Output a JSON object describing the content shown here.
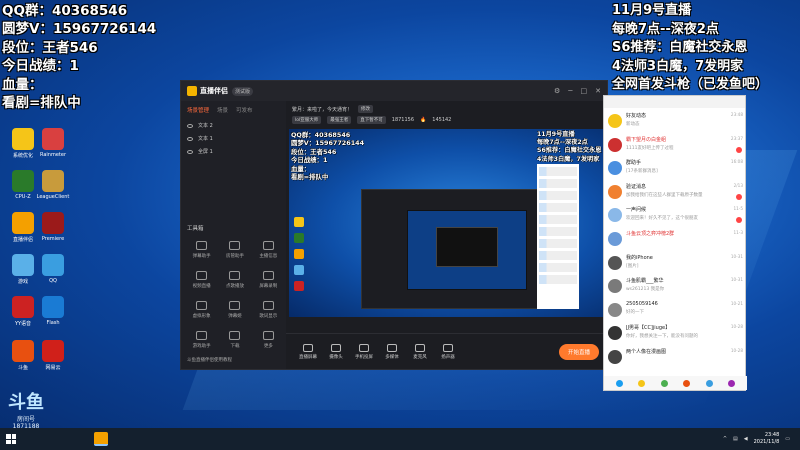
{
  "overlay_left": {
    "line1": "QQ群：40368546",
    "line2": "圆梦V：15967726144",
    "line3": "段位：王者546",
    "line4": "今日战绩：1",
    "line5": "血量：",
    "line6": "看剧=排队中"
  },
  "overlay_right": {
    "line1": "11月9号直播",
    "line2": "每晚7点--深夜2点",
    "line3": "S6推荐：白魔社交永恩",
    "line4": "4法师3白魔，7发明家",
    "line5": "全网首发斗枪（已发鱼吧）"
  },
  "desktop_icons": [
    {
      "label": "系统优化",
      "color": "#f5c518"
    },
    {
      "label": "Rainmeter",
      "color": "#d94040"
    },
    {
      "label": "CPU-Z",
      "color": "#2a7a2a"
    },
    {
      "label": "LeagueClient",
      "color": "#c89b3c"
    },
    {
      "label": "直播伴侣",
      "color": "#f4a000"
    },
    {
      "label": "Premiere",
      "color": "#9b1a1a"
    },
    {
      "label": "游戏",
      "color": "#5ab0e8"
    },
    {
      "label": "QQ",
      "color": "#3a9ee0"
    },
    {
      "label": "YY语音",
      "color": "#c22"
    },
    {
      "label": "Flash",
      "color": "#1a7bd4"
    },
    {
      "label": "斗鱼",
      "color": "#e85010"
    },
    {
      "label": "网易云",
      "color": "#d0201a"
    }
  ],
  "app": {
    "logo": "直播伴侣",
    "version": "测试版",
    "side_tabs": [
      "场景管理",
      "场景",
      "可发布"
    ],
    "scenes": [
      "文本 2",
      "文本 1",
      "全屏 1"
    ],
    "tools_title": "工具箱",
    "tools": [
      "弹幕助手",
      "房管助手",
      "主播信息",
      "视频直播",
      "点歌播放",
      "屏幕录制",
      "虚拟形象",
      "弹幕姬",
      "歌词显示",
      "游戏助手",
      "下载",
      "更多"
    ],
    "info_line": "繁月：来啦了，今天通宵！",
    "info_btn": "修改",
    "room_badge": "lol亚服大师",
    "rank_badge": "最强王者",
    "audience_label": "直下暂不可",
    "audience_count": "1871156",
    "hot_count": "145142",
    "bottom_tools": [
      "直播屏幕",
      "摄像头",
      "手机投屏",
      "多媒体",
      "麦克风",
      "扬声器"
    ],
    "start_live": "开始直播",
    "tip": "斗鱼直播伴侣使用教程"
  },
  "qq": {
    "items": [
      {
        "name": "好友动态",
        "msg": "新动态",
        "time": "23:48",
        "color": "#f5c518",
        "dot": false
      },
      {
        "name": "霸下望月の白金組",
        "msg": "1111友好吧上传了过程",
        "time": "23:37",
        "color": "#cc3030",
        "dot": true,
        "red": true
      },
      {
        "name": "群助手",
        "msg": "[17条新群消息]",
        "time": "16:08",
        "color": "#4a8fe0",
        "dot": false
      },
      {
        "name": "验证消息",
        "msg": "加我给我们在这些人群里下载原子数量",
        "time": "2/13",
        "color": "#f08030",
        "dot": true
      },
      {
        "name": "一声问候",
        "msg": "欢迎回来！好久不见了，这个很朋友",
        "time": "11-5",
        "color": "#8ab8e8",
        "dot": true
      },
      {
        "name": "斗鱼云顶之弈冲榜2群",
        "msg": "",
        "time": "11-3",
        "color": "#6a9ad8",
        "dot": false,
        "red": true
      },
      {
        "name": "我的iPhone",
        "msg": "[图片]",
        "time": "10-31",
        "color": "#555",
        "dot": false
      },
      {
        "name": "斗鱼肌霸___繁华",
        "msg": "ws261213 我是你",
        "time": "10-31",
        "color": "#7a7a7a",
        "dot": false
      },
      {
        "name": "2505059146",
        "msg": "好的一下",
        "time": "10-21",
        "color": "#888",
        "dot": false
      },
      {
        "name": "JJ男哥【CC]jiuge】",
        "msg": "你好，我想关注一下，能没有问题的",
        "time": "10-28",
        "color": "#333",
        "dot": false
      },
      {
        "name": "两个人像在漫画图",
        "msg": "",
        "time": "10-28",
        "color": "#444",
        "dot": false
      }
    ]
  },
  "taskbar": {
    "time": "23:48",
    "date": "2021/11/8"
  },
  "watermark": {
    "brand": "斗鱼",
    "room": "房间号",
    "room_no": "1871188"
  }
}
